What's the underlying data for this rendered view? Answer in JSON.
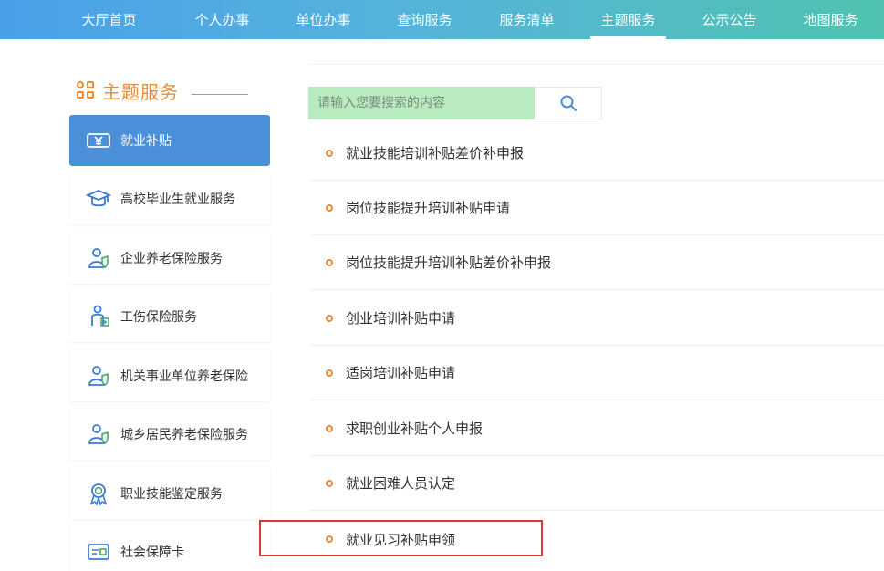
{
  "nav": {
    "items": [
      {
        "label": "大厅首页"
      },
      {
        "label": "个人办事"
      },
      {
        "label": "单位办事"
      },
      {
        "label": "查询服务"
      },
      {
        "label": "服务清单"
      },
      {
        "label": "主题服务",
        "active": true
      },
      {
        "label": "公示公告"
      },
      {
        "label": "地图服务"
      }
    ]
  },
  "sidebar": {
    "title": "主题服务",
    "accent_color": "#e98c3a",
    "active_color": "#4a90d9",
    "items": [
      {
        "label": "就业补贴",
        "icon": "money-icon",
        "active": true
      },
      {
        "label": "高校毕业生就业服务",
        "icon": "graduation-cap-icon"
      },
      {
        "label": "企业养老保险服务",
        "icon": "person-shield-icon"
      },
      {
        "label": "工伤保险服务",
        "icon": "injury-icon"
      },
      {
        "label": "机关事业单位养老保险",
        "icon": "person-shield-icon"
      },
      {
        "label": "城乡居民养老保险服务",
        "icon": "person-shield-icon"
      },
      {
        "label": "职业技能鉴定服务",
        "icon": "award-icon"
      },
      {
        "label": "社会保障卡",
        "icon": "card-icon"
      }
    ]
  },
  "search": {
    "placeholder": "请输入您要搜索的内容",
    "icon": "search-icon"
  },
  "services": [
    {
      "label": "就业技能培训补贴差价补申报"
    },
    {
      "label": "岗位技能提升培训补贴申请"
    },
    {
      "label": "岗位技能提升培训补贴差价补申报"
    },
    {
      "label": "创业培训补贴申请"
    },
    {
      "label": "适岗培训补贴申请"
    },
    {
      "label": "求职创业补贴个人申报"
    },
    {
      "label": "就业困难人员认定"
    },
    {
      "label": "就业见习补贴申领",
      "highlighted": true
    }
  ]
}
